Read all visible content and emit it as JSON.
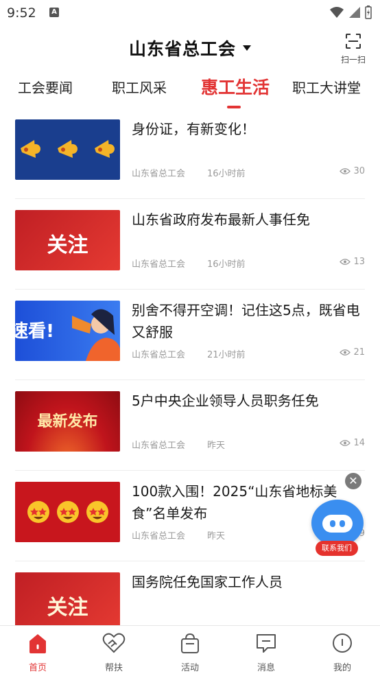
{
  "status_bar": {
    "time": "9:52",
    "notification_letter": "A"
  },
  "header": {
    "title": "山东省总工会",
    "scan_label": "扫一扫"
  },
  "tabs": [
    {
      "label": "工会要闻"
    },
    {
      "label": "职工风采"
    },
    {
      "label": "惠工生活",
      "active": true
    },
    {
      "label": "职工大讲堂"
    }
  ],
  "articles": [
    {
      "title": "身份证，有新变化！",
      "source": "山东省总工会",
      "time": "16小时前",
      "views": "30",
      "thumb_icon": "megaphone-icon"
    },
    {
      "title": "山东省政府发布最新人事任免",
      "source": "山东省总工会",
      "time": "16小时前",
      "views": "13",
      "thumb_text": "关注"
    },
    {
      "title": "别舍不得开空调！记住这5点，既省电又舒服",
      "source": "山东省总工会",
      "time": "21小时前",
      "views": "21",
      "thumb_text": "速看!"
    },
    {
      "title": "5户中央企业领导人员职务任免",
      "source": "山东省总工会",
      "time": "昨天",
      "views": "14",
      "thumb_text": "最新发布"
    },
    {
      "title": "100款入围！2025“山东省地标美食”名单发布",
      "source": "山东省总工会",
      "time": "昨天",
      "views": "9",
      "thumb_icon": "star-struck-emoji-icon"
    },
    {
      "title": "国务院任免国家工作人员",
      "thumb_text": "关注"
    }
  ],
  "floating_assistant": {
    "label": "联系我们"
  },
  "bottom_nav": [
    {
      "label": "首页",
      "active": true
    },
    {
      "label": "帮扶"
    },
    {
      "label": "活动"
    },
    {
      "label": "消息"
    },
    {
      "label": "我的"
    }
  ],
  "colors": {
    "accent": "#e23434",
    "robot_blue": "#3a8ef0",
    "text_meta": "#9a9a9a"
  }
}
